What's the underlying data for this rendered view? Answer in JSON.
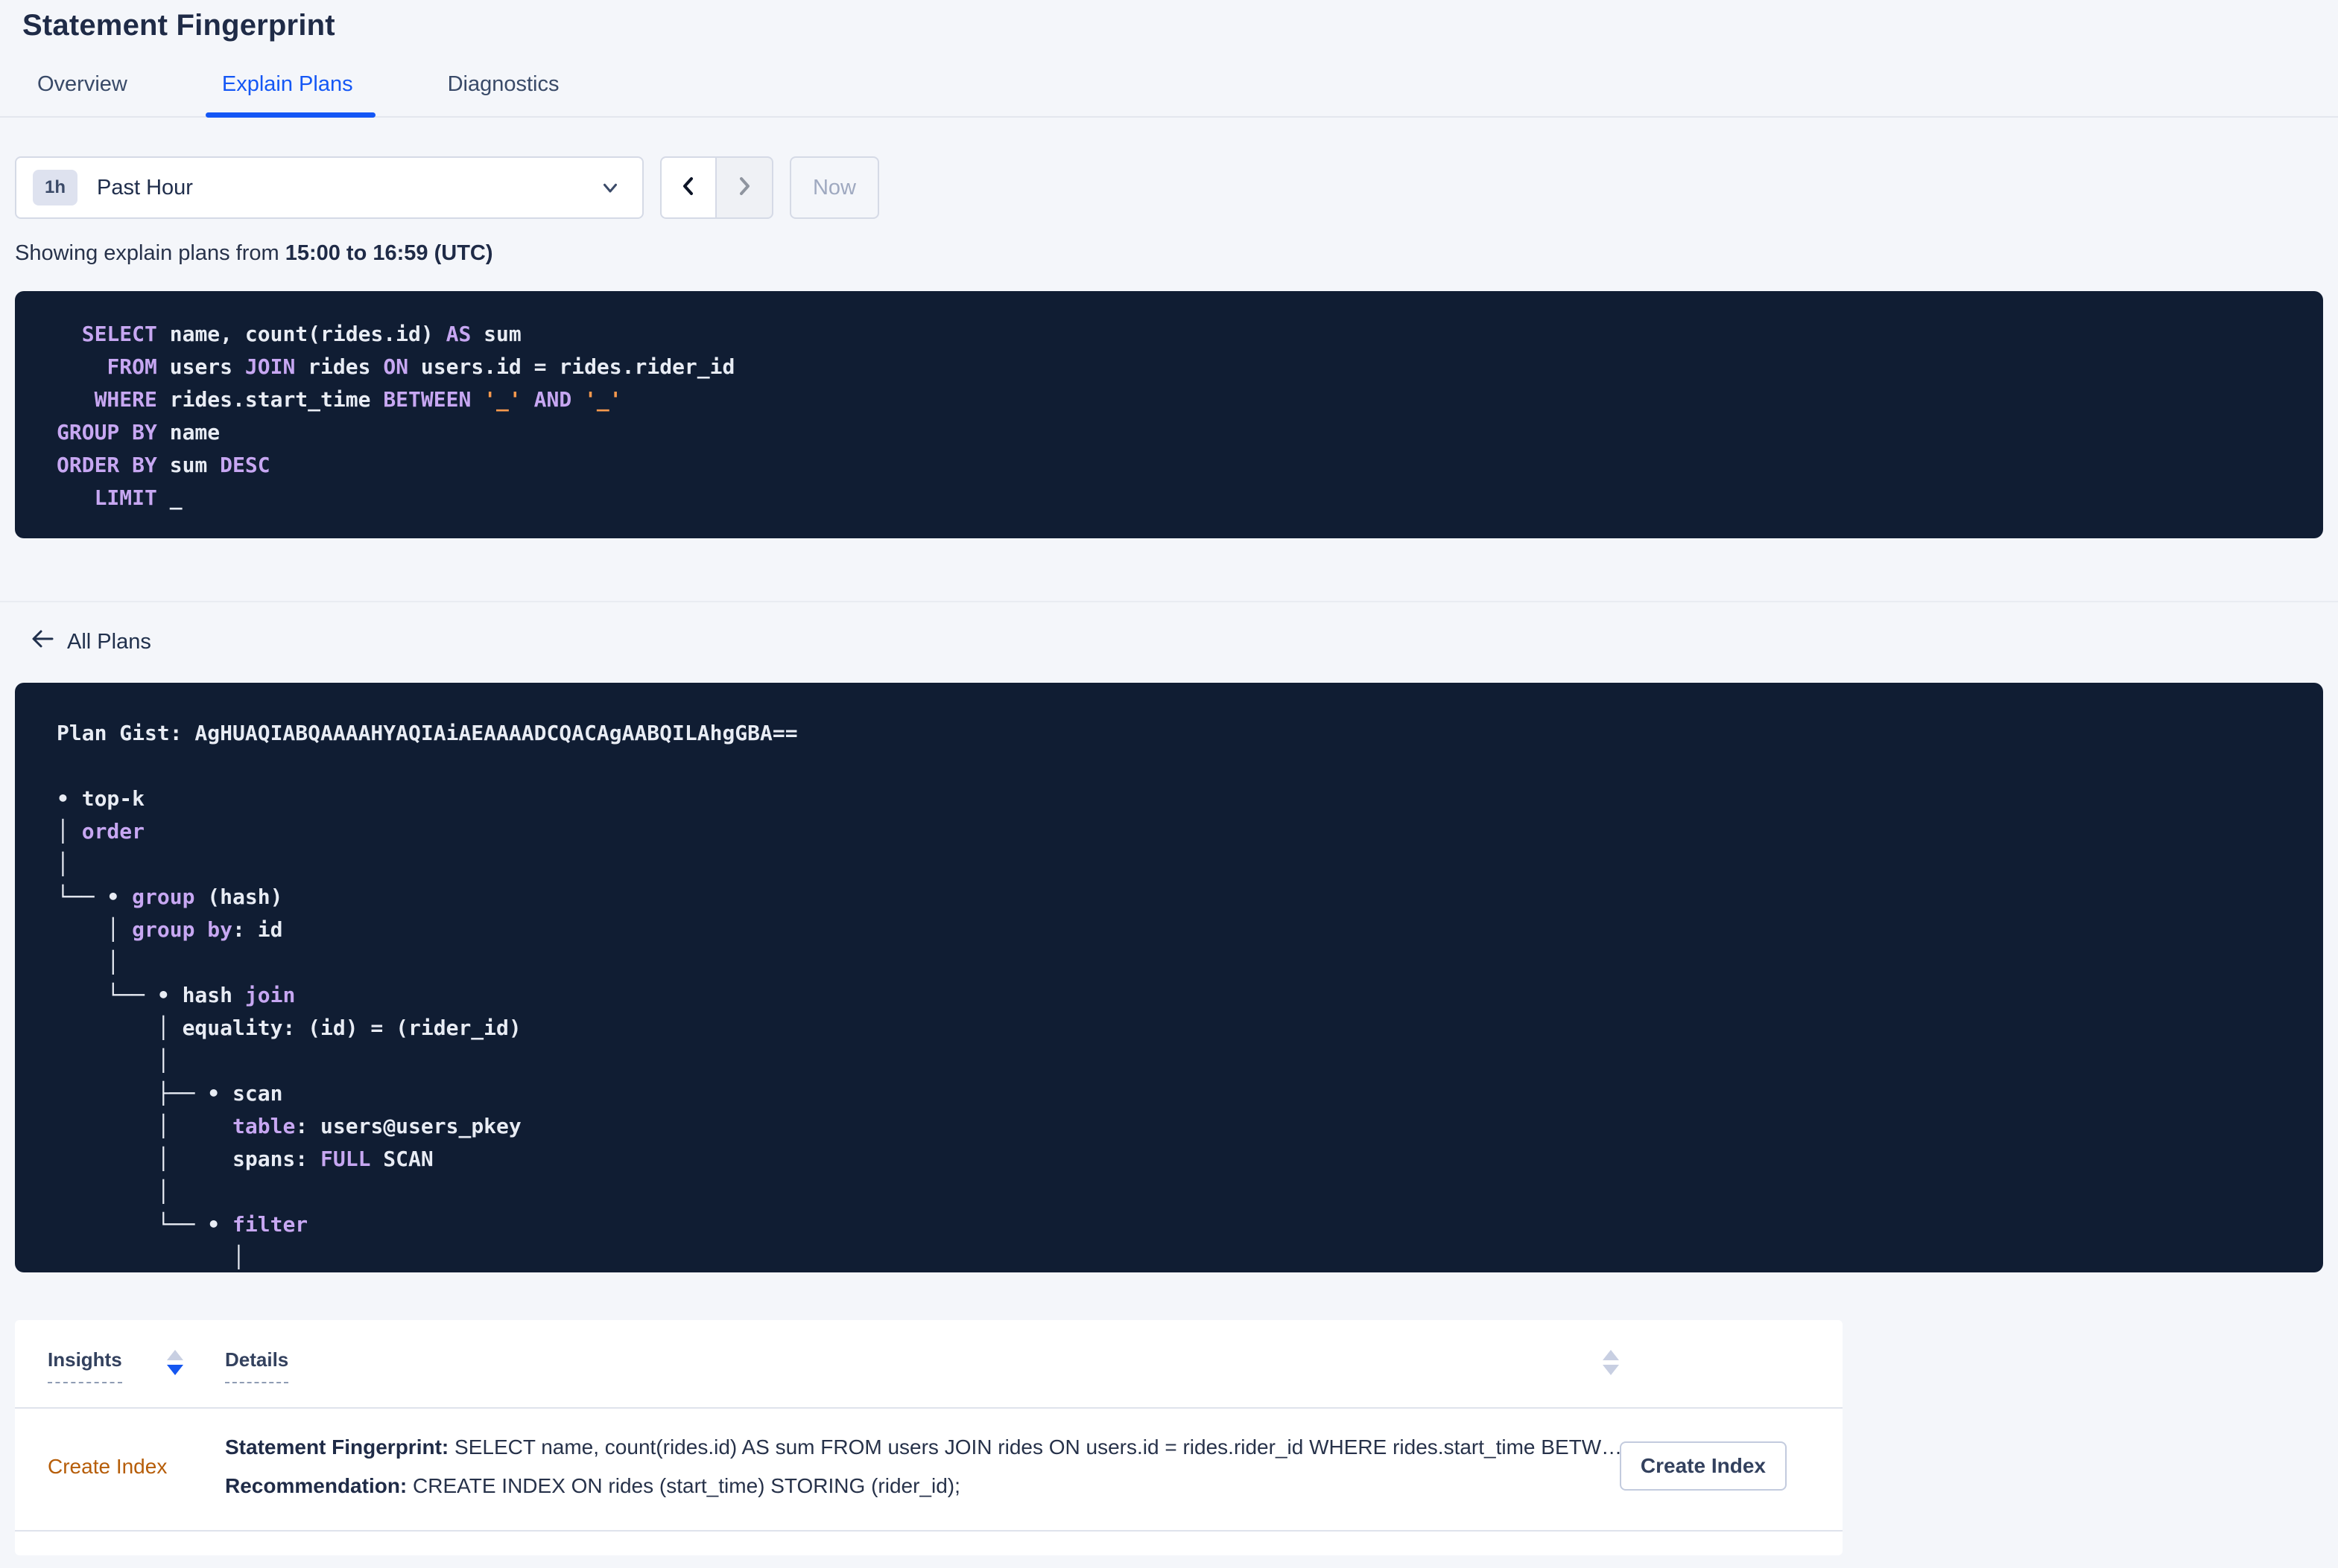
{
  "page": {
    "title": "Statement Fingerprint"
  },
  "tabs": [
    {
      "label": "Overview",
      "active": false
    },
    {
      "label": "Explain Plans",
      "active": true
    },
    {
      "label": "Diagnostics",
      "active": false
    }
  ],
  "time_controls": {
    "range_badge": "1h",
    "range_label": "Past Hour",
    "now_label": "Now"
  },
  "caption": {
    "prefix": "Showing explain plans from ",
    "range_bold": "15:00 to 16:59 (UTC)"
  },
  "sql_block": {
    "lines": [
      [
        {
          "t": "  ",
          "c": "p"
        },
        {
          "t": "SELECT",
          "c": "k"
        },
        {
          "t": " name, count(rides.id) ",
          "c": "p"
        },
        {
          "t": "AS",
          "c": "k"
        },
        {
          "t": " sum",
          "c": "p"
        }
      ],
      [
        {
          "t": "    ",
          "c": "p"
        },
        {
          "t": "FROM",
          "c": "k"
        },
        {
          "t": " users ",
          "c": "p"
        },
        {
          "t": "JOIN",
          "c": "k"
        },
        {
          "t": " rides ",
          "c": "p"
        },
        {
          "t": "ON",
          "c": "k"
        },
        {
          "t": " users.id = rides.rider_id",
          "c": "p"
        }
      ],
      [
        {
          "t": "   ",
          "c": "p"
        },
        {
          "t": "WHERE",
          "c": "k"
        },
        {
          "t": " rides.start_time ",
          "c": "p"
        },
        {
          "t": "BETWEEN",
          "c": "k"
        },
        {
          "t": " ",
          "c": "p"
        },
        {
          "t": "'_'",
          "c": "s"
        },
        {
          "t": " ",
          "c": "p"
        },
        {
          "t": "AND",
          "c": "k"
        },
        {
          "t": " ",
          "c": "p"
        },
        {
          "t": "'_'",
          "c": "s"
        }
      ],
      [
        {
          "t": "GROUP BY",
          "c": "k"
        },
        {
          "t": " name",
          "c": "p"
        }
      ],
      [
        {
          "t": "ORDER BY",
          "c": "k"
        },
        {
          "t": " sum ",
          "c": "p"
        },
        {
          "t": "DESC",
          "c": "k"
        }
      ],
      [
        {
          "t": "   ",
          "c": "p"
        },
        {
          "t": "LIMIT",
          "c": "k"
        },
        {
          "t": " _",
          "c": "p"
        }
      ]
    ]
  },
  "all_plans_label": "All Plans",
  "plan_gist": {
    "gist_label": "Plan Gist: AgHUAQIABQAAAAHYAQIAiAEAAAADCQACAgAABQILAhgGBA==",
    "lines": [
      [
        {
          "t": "Plan Gist: AgHUAQIABQAAAAHYAQIAiAEAAAADCQACAgAABQILAhgGBA==",
          "c": "p"
        }
      ],
      [],
      [
        {
          "t": "• top-k",
          "c": "p"
        }
      ],
      [
        {
          "t": "│ ",
          "c": "p"
        },
        {
          "t": "order",
          "c": "k"
        }
      ],
      [
        {
          "t": "│",
          "c": "p"
        }
      ],
      [
        {
          "t": "└── • ",
          "c": "p"
        },
        {
          "t": "group",
          "c": "k"
        },
        {
          "t": " (hash)",
          "c": "p"
        }
      ],
      [
        {
          "t": "    │ ",
          "c": "p"
        },
        {
          "t": "group by",
          "c": "k"
        },
        {
          "t": ": id",
          "c": "p"
        }
      ],
      [
        {
          "t": "    │",
          "c": "p"
        }
      ],
      [
        {
          "t": "    └── • hash ",
          "c": "p"
        },
        {
          "t": "join",
          "c": "k"
        }
      ],
      [
        {
          "t": "        │ equality: (id) = (rider_id)",
          "c": "p"
        }
      ],
      [
        {
          "t": "        │",
          "c": "p"
        }
      ],
      [
        {
          "t": "        ├── • scan",
          "c": "p"
        }
      ],
      [
        {
          "t": "        │     ",
          "c": "p"
        },
        {
          "t": "table",
          "c": "k"
        },
        {
          "t": ": users@users_pkey",
          "c": "p"
        }
      ],
      [
        {
          "t": "        │     spans: ",
          "c": "p"
        },
        {
          "t": "FULL",
          "c": "k"
        },
        {
          "t": " SCAN",
          "c": "p"
        }
      ],
      [
        {
          "t": "        │",
          "c": "p"
        }
      ],
      [
        {
          "t": "        └── • ",
          "c": "p"
        },
        {
          "t": "filter",
          "c": "k"
        }
      ],
      [
        {
          "t": "              │",
          "c": "p"
        }
      ]
    ]
  },
  "insights_table": {
    "columns": [
      {
        "label": "Insights"
      },
      {
        "label": "Details"
      }
    ],
    "rows": [
      {
        "insight": "Create Index",
        "fingerprint_label": "Statement Fingerprint:",
        "fingerprint_text": " SELECT name, count(rides.id) AS sum FROM users JOIN rides ON users.id = rides.rider_id WHERE rides.start_time BETWEEN '_…",
        "recommendation_label": "Recommendation:",
        "recommendation_text": " CREATE INDEX ON rides (start_time) STORING (rider_id);",
        "action_label": "Create Index"
      }
    ]
  },
  "colors": {
    "accent_blue": "#1457f5",
    "code_background": "#101d33",
    "code_keyword": "#c7a7f2",
    "code_plain": "#e8ecf4",
    "code_string": "#f9994d",
    "insight_link_orange": "#b65d08",
    "page_background": "#f4f6fa"
  },
  "icons": {
    "arrow_left": "back-arrow",
    "chevron_down": "dropdown-chevron",
    "chevron_left": "previous-range",
    "chevron_right": "next-range",
    "sort_asc": "sort-ascending-triangle",
    "sort_desc": "sort-descending-triangle"
  }
}
